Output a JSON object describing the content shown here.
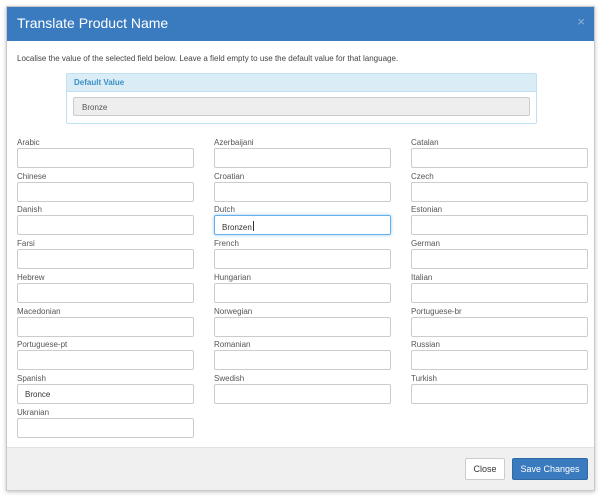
{
  "modal": {
    "title": "Translate Product Name",
    "close_glyph": "×"
  },
  "instructions": "Localise the value of the selected field below. Leave a field empty to use the default value for that language.",
  "default_value": {
    "title": "Default Value",
    "value": "Bronze"
  },
  "fields": [
    {
      "label": "Arabic",
      "value": ""
    },
    {
      "label": "Azerbaijani",
      "value": ""
    },
    {
      "label": "Catalan",
      "value": ""
    },
    {
      "label": "Chinese",
      "value": ""
    },
    {
      "label": "Croatian",
      "value": ""
    },
    {
      "label": "Czech",
      "value": ""
    },
    {
      "label": "Danish",
      "value": ""
    },
    {
      "label": "Dutch",
      "value": "Bronzen"
    },
    {
      "label": "Estonian",
      "value": ""
    },
    {
      "label": "Farsi",
      "value": ""
    },
    {
      "label": "French",
      "value": ""
    },
    {
      "label": "German",
      "value": ""
    },
    {
      "label": "Hebrew",
      "value": ""
    },
    {
      "label": "Hungarian",
      "value": ""
    },
    {
      "label": "Italian",
      "value": ""
    },
    {
      "label": "Macedonian",
      "value": ""
    },
    {
      "label": "Norwegian",
      "value": ""
    },
    {
      "label": "Portuguese-br",
      "value": ""
    },
    {
      "label": "Portuguese-pt",
      "value": ""
    },
    {
      "label": "Romanian",
      "value": ""
    },
    {
      "label": "Russian",
      "value": ""
    },
    {
      "label": "Spanish",
      "value": "Bronce"
    },
    {
      "label": "Swedish",
      "value": ""
    },
    {
      "label": "Turkish",
      "value": ""
    },
    {
      "label": "Ukranian",
      "value": ""
    }
  ],
  "focused_field": "Dutch",
  "footer": {
    "close_label": "Close",
    "save_label": "Save Changes"
  },
  "colors": {
    "header": "#3a7bbf",
    "primary_button": "#3a7bbf",
    "panel_heading": "#daedf7",
    "focus_border": "#66afe9"
  }
}
